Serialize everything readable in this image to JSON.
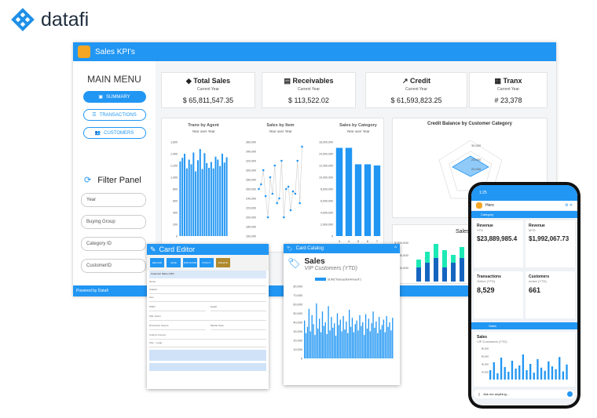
{
  "brand": {
    "name": "datafi"
  },
  "dashboard": {
    "title": "Sales KPI's",
    "menu_title": "MAIN MENU",
    "nav": [
      {
        "label": "SUMMARY"
      },
      {
        "label": "TRANSACTIONS"
      },
      {
        "label": "CUSTOMERS"
      }
    ],
    "filter_title": "Filter Panel",
    "filters": [
      "Year",
      "Buying Group",
      "Category ID",
      "CustomerID"
    ],
    "footer": "Powered by Datafi",
    "kpis": [
      {
        "title": "Total Sales",
        "sub": "Current Year",
        "value": "$ 65,811,547.35"
      },
      {
        "title": "Receivables",
        "sub": "Current Year",
        "value": "$ 113,522.02"
      },
      {
        "title": "Credit",
        "sub": "Current Year",
        "value": "$ 61,593,823.25"
      },
      {
        "title": "Tranx",
        "sub": "Current Year",
        "value": "# 23,378"
      }
    ],
    "charts": {
      "agent": {
        "title": "Tranx by Agent",
        "sub": "Year over Year",
        "yticks": [
          "1,600",
          "1,400",
          "1,200",
          "1,000",
          "800",
          "600",
          "400",
          "200",
          "0"
        ],
        "values": [
          1270,
          1330,
          1400,
          1150,
          1300,
          1220,
          1420,
          1100,
          1290,
          1480,
          1140,
          1410,
          1240,
          1160,
          1260,
          1150,
          1350,
          1300,
          1190,
          1400,
          1250,
          1340
        ]
      },
      "item": {
        "title": "Sales by Item",
        "sub": "Year over Year",
        "yticks": [
          "360,000",
          "340,000",
          "320,000",
          "300,000",
          "280,000",
          "260,000",
          "240,000",
          "220,000",
          "200,000",
          "180,000",
          "160,000"
        ],
        "values": [
          260000,
          270000,
          300000,
          245000,
          200000,
          285000,
          250000,
          310000,
          230000,
          240000,
          320000,
          200000,
          260000,
          265000,
          215000,
          255000,
          250000,
          320000,
          230000,
          350000
        ]
      },
      "category": {
        "title": "Sales by Category",
        "sub": "Year over Year",
        "yticks": [
          "16,000,000",
          "14,000,000",
          "12,000,000",
          "10,000,000",
          "8,000,000",
          "6,000,000",
          "4,000,000",
          "2,000,000",
          "0"
        ],
        "categories": [
          "3",
          "4",
          "5",
          "6",
          "7"
        ],
        "values": [
          15000000,
          15000000,
          12200000,
          12200000,
          12000000
        ]
      },
      "credit": {
        "title": "Credit Balance by Customer Category",
        "rings": [
          "30,000",
          "25,000",
          "20,000"
        ]
      },
      "top": {
        "title": "y Top Cu"
      },
      "salesby": {
        "title": "Sales by",
        "yticks": [
          "5,000,000",
          "4,000,000",
          "3,000,000"
        ]
      }
    }
  },
  "editor": {
    "title": "Card Editor",
    "buttons": [
      "RELOAD",
      "SAVE",
      "DUPLICATE",
      "POLICY",
      "DELETE"
    ],
    "fields": [
      "Name",
      "Caption",
      "Icon",
      "Width",
      "Height",
      "SQL Query",
      "Dimension Source",
      "Column Format",
      "Size"
    ],
    "size_value": "Large",
    "combo": "Customer Name (VIP)",
    "data_label": "Tabular Data"
  },
  "catalog": {
    "title": "Card Catalog",
    "card_title": "Sales",
    "card_sub": "VIP Customers (YTD)",
    "legend": "SUM(\"TransactionAmount\")",
    "yticks": [
      "80,000",
      "70,000",
      "60,000",
      "50,000",
      "40,000",
      "30,000",
      "20,000",
      "10,000",
      "0"
    ],
    "values": [
      42000,
      28000,
      35000,
      55000,
      30000,
      48000,
      38000,
      26000,
      61000,
      33000,
      44000,
      29000,
      52000,
      36000,
      40000,
      27000,
      58000,
      31000,
      46000,
      34000,
      39000,
      25000,
      50000,
      37000,
      43000,
      30000,
      47000,
      32000,
      41000,
      28000,
      54000,
      35000,
      45000,
      29000,
      38000,
      42000,
      31000,
      48000,
      36000,
      40000,
      26000,
      49000,
      33000,
      44000,
      30000,
      39000,
      52000,
      34000,
      41000,
      28000,
      46000,
      32000,
      37000,
      43000,
      29000,
      47000,
      35000,
      40000,
      31000,
      45000
    ]
  },
  "phone": {
    "time": "1:25",
    "app_label": "Hero",
    "category_label": "Category",
    "tiles": [
      {
        "title": "Revenue",
        "sub": "YTD",
        "value": "$23,889,985.4"
      },
      {
        "title": "Revenue",
        "sub": "MTD",
        "value": "$1,992,067.73"
      },
      {
        "title": "Transactions",
        "sub": "Online (YTD)",
        "value": "8,529"
      },
      {
        "title": "Customers",
        "sub": "Active (YTD)",
        "value": "661"
      }
    ],
    "sales_section": "Sales",
    "sales_card": {
      "title": "Sales",
      "sub": "VIP Customers (YTD)",
      "yticks": [
        "80,000",
        "60,000",
        "40,000",
        "20,000"
      ],
      "values": [
        30,
        55,
        20,
        70,
        40,
        25,
        60,
        35,
        45,
        80,
        30,
        50,
        22,
        65,
        38,
        28,
        58,
        42,
        33,
        72,
        26,
        48
      ]
    },
    "ask": "Ask me anything..."
  },
  "colors": {
    "accent": "#2196f3",
    "orange": "#f5a623",
    "teal": "#1de9b6"
  }
}
